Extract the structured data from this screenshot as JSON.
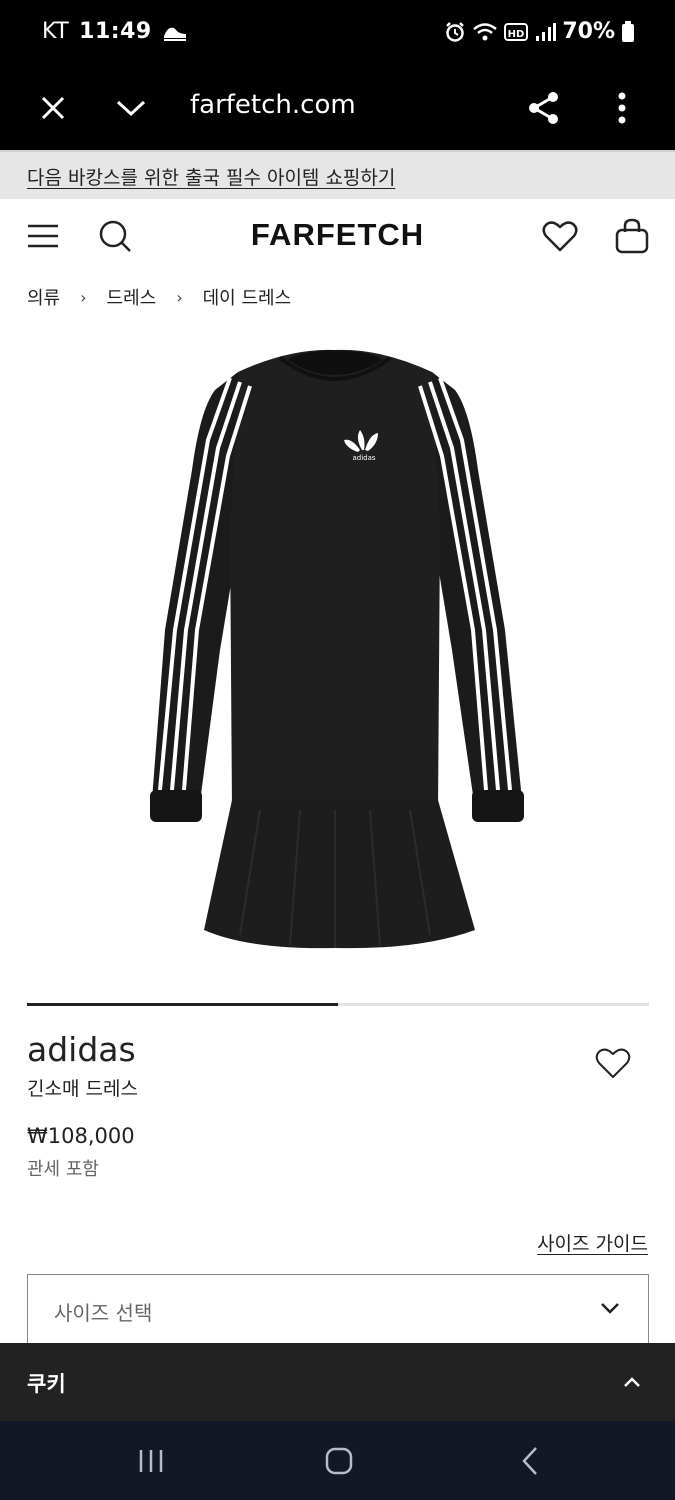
{
  "status_bar": {
    "carrier": "KT",
    "time": "11:49",
    "battery": "70%"
  },
  "browser": {
    "url": "farfetch.com"
  },
  "promo": {
    "text": "다음 바캉스를 위한 출국 필수 아이템 쇼핑하기"
  },
  "header": {
    "logo": "FARFETCH"
  },
  "breadcrumb": {
    "items": [
      "의류",
      "드레스",
      "데이 드레스"
    ],
    "separator": "›"
  },
  "gallery": {
    "current_fraction": 0.5
  },
  "product": {
    "brand": "adidas",
    "name": "긴소매 드레스",
    "price": "₩108,000",
    "duty_note": "관세 포함",
    "image_logo_text": "adidas",
    "colors": {
      "garment": "#1b1b1b",
      "stripes": "#ffffff"
    }
  },
  "size": {
    "guide_label": "사이즈 가이드",
    "select_placeholder": "사이즈 선택"
  },
  "cookie": {
    "label": "쿠키"
  },
  "icons": {
    "status_bar": [
      "alarm-icon",
      "wifi-icon",
      "hd-icon",
      "signal-icon",
      "battery-icon",
      "notification-icon"
    ],
    "browser": [
      "close-icon",
      "chevron-down-icon",
      "share-icon",
      "more-vertical-icon"
    ],
    "header": [
      "menu-icon",
      "search-icon",
      "heart-icon",
      "bag-icon"
    ],
    "nav": [
      "recent-apps-icon",
      "home-icon",
      "back-icon"
    ]
  }
}
